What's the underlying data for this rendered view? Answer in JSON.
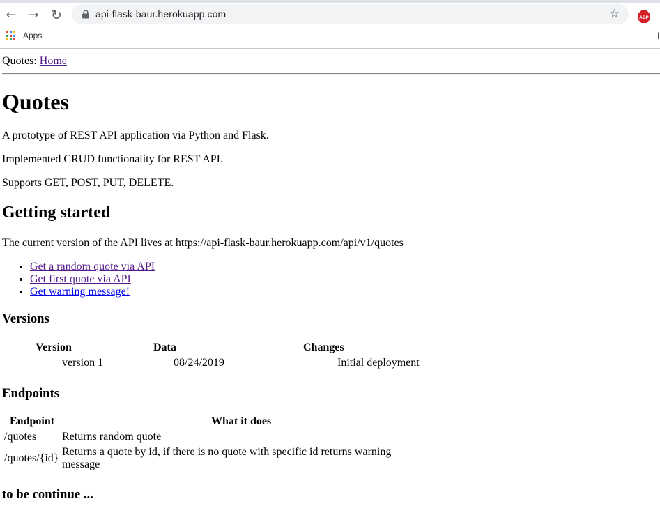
{
  "browser": {
    "url": "api-flask-baur.herokuapp.com",
    "bookmarks": {
      "apps_label": "Apps"
    },
    "extension_label": "ABP",
    "icons": [
      "back-arrow-icon",
      "forward-arrow-icon",
      "reload-icon",
      "lock-icon",
      "star-icon",
      "adblock-icon",
      "apps-grid-icon"
    ]
  },
  "page": {
    "breadcrumb": {
      "prefix": "Quotes: ",
      "home_link": "Home"
    },
    "title": "Quotes",
    "intro": [
      "A prototype of REST API application via Python and Flask.",
      "Implemented CRUD functionality for REST API.",
      "Supports GET, POST, PUT, DELETE."
    ],
    "getting_started": {
      "heading": "Getting started",
      "text": "The current version of the API lives at https://api-flask-baur.herokuapp.com/api/v1/quotes",
      "links": [
        "Get a random quote via API",
        "Get first quote via API",
        "Get warning message!"
      ]
    },
    "versions": {
      "heading": "Versions",
      "headers": [
        "Version",
        "Data",
        "Changes"
      ],
      "rows": [
        [
          "version 1",
          "08/24/2019",
          "Initial deployment"
        ]
      ]
    },
    "endpoints": {
      "heading": "Endpoints",
      "headers": [
        "Endpoint",
        "What it does"
      ],
      "rows": [
        [
          "/quotes",
          "Returns random quote"
        ],
        [
          "/quotes/{id}",
          "Returns a quote by id, if there is no quote with specific id returns warning",
          "message"
        ]
      ]
    },
    "footer_note": "to be continue ..."
  },
  "colors": {
    "visited_link": "#551a8b",
    "unvisited_link": "#0000ee",
    "abp_red": "#d32027"
  }
}
